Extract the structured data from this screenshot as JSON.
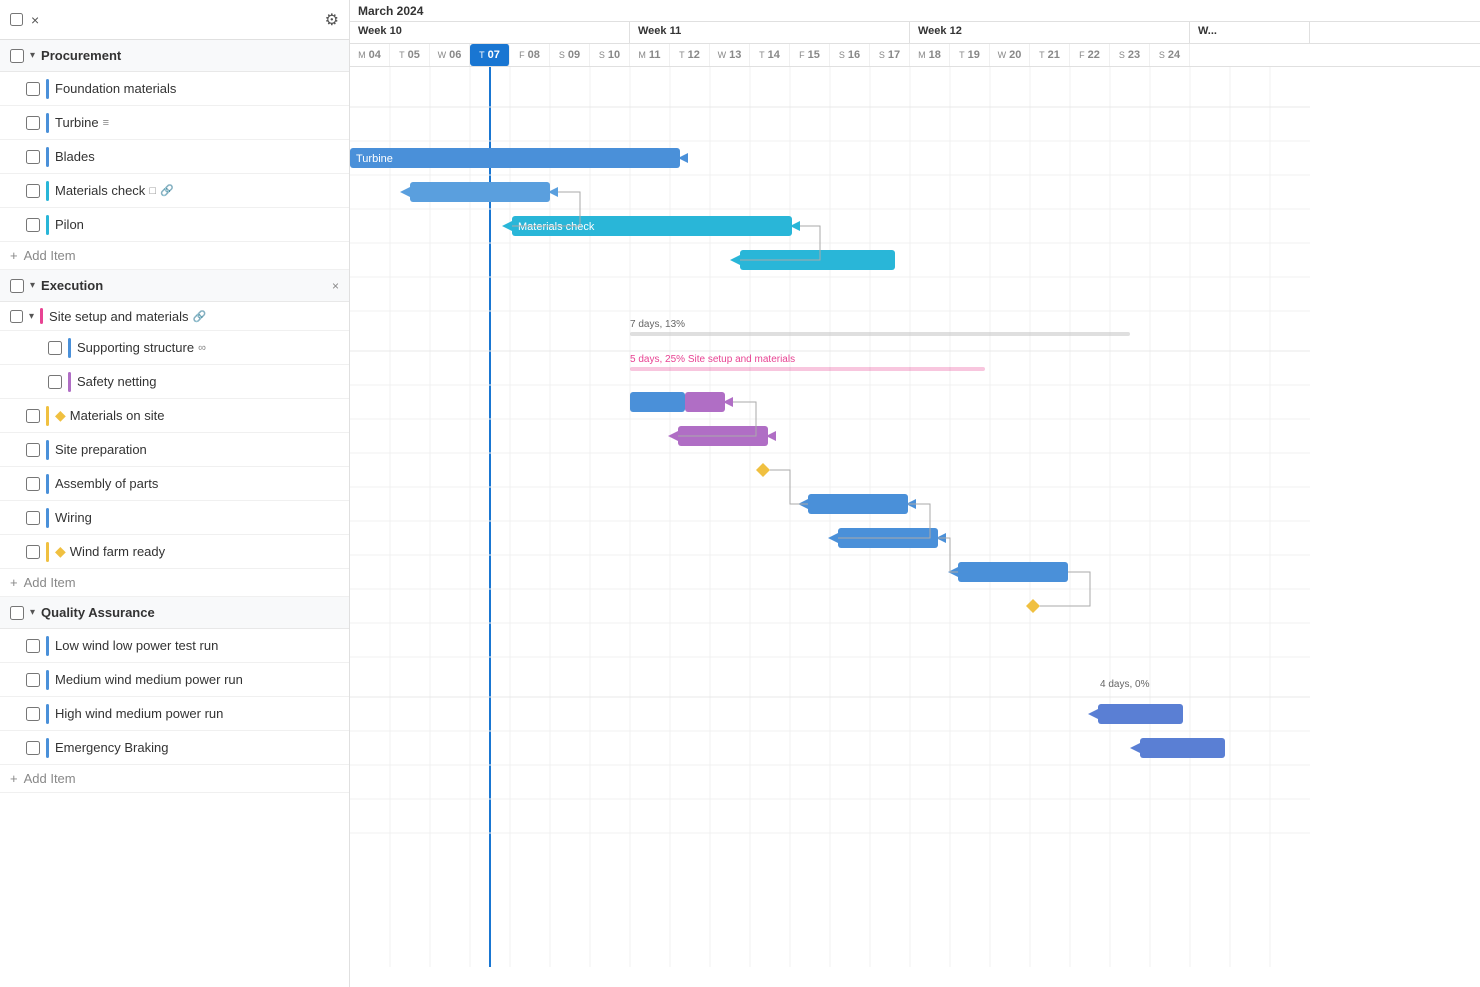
{
  "month": "March 2024",
  "weeks": [
    {
      "label": "Week 10",
      "days": [
        {
          "letter": "M",
          "num": "04"
        },
        {
          "letter": "T",
          "num": "05"
        },
        {
          "letter": "W",
          "num": "06"
        },
        {
          "letter": "T",
          "num": "07",
          "today": true
        },
        {
          "letter": "F",
          "num": "08"
        },
        {
          "letter": "S",
          "num": "09"
        },
        {
          "letter": "S",
          "num": "10"
        }
      ]
    },
    {
      "label": "Week 11",
      "days": [
        {
          "letter": "M",
          "num": "11"
        },
        {
          "letter": "T",
          "num": "12"
        },
        {
          "letter": "W",
          "num": "13"
        },
        {
          "letter": "T",
          "num": "14"
        },
        {
          "letter": "F",
          "num": "15"
        },
        {
          "letter": "S",
          "num": "16"
        },
        {
          "letter": "S",
          "num": "17"
        }
      ]
    },
    {
      "label": "Week 12",
      "days": [
        {
          "letter": "M",
          "num": "18"
        },
        {
          "letter": "T",
          "num": "19"
        },
        {
          "letter": "W",
          "num": "20"
        },
        {
          "letter": "T",
          "num": "21"
        },
        {
          "letter": "F",
          "num": "22"
        },
        {
          "letter": "S",
          "num": "23"
        },
        {
          "letter": "S",
          "num": "24"
        }
      ]
    }
  ],
  "groups": [
    {
      "title": "Procurement",
      "items": [
        {
          "label": "Foundation materials",
          "color": "#4a90d9",
          "indent": 1
        },
        {
          "label": "Turbine",
          "color": "#4a90d9",
          "indent": 1,
          "icons": "≡"
        },
        {
          "label": "Blades",
          "color": "#4a90d9",
          "indent": 1
        },
        {
          "label": "Materials check",
          "color": "#29b6d8",
          "indent": 1,
          "icons": "□ 🔗"
        },
        {
          "label": "Pilon",
          "color": "#29b6d8",
          "indent": 1
        }
      ],
      "addItem": "+ Add Item"
    },
    {
      "title": "Execution",
      "closeable": true,
      "subgroups": [
        {
          "label": "Site setup and materials",
          "color": "#e84393",
          "indent": 1,
          "icon": "🔗",
          "items": [
            {
              "label": "Supporting structure",
              "color": "#4a90d9",
              "indent": 2,
              "icons": "∞"
            },
            {
              "label": "Safety netting",
              "color": "#b06ec5",
              "indent": 2
            }
          ]
        }
      ],
      "items": [
        {
          "label": "Materials on site",
          "color": "#f0c040",
          "indent": 1,
          "diamond": true
        },
        {
          "label": "Site preparation",
          "color": "#4a90d9",
          "indent": 1
        },
        {
          "label": "Assembly of parts",
          "color": "#4a90d9",
          "indent": 1
        },
        {
          "label": "Wiring",
          "color": "#4a90d9",
          "indent": 1
        },
        {
          "label": "Wind farm ready",
          "color": "#f0c040",
          "indent": 1,
          "diamond": true
        }
      ],
      "addItem": "+ Add Item"
    },
    {
      "title": "Quality Assurance",
      "items": [
        {
          "label": "Low wind low power test run",
          "color": "#4a90d9",
          "indent": 1
        },
        {
          "label": "Medium wind medium power run",
          "color": "#4a90d9",
          "indent": 1
        },
        {
          "label": "High wind medium power run",
          "color": "#4a90d9",
          "indent": 1
        },
        {
          "label": "Emergency Braking",
          "color": "#4a90d9",
          "indent": 1
        }
      ],
      "addItem": "+ Add Item"
    }
  ],
  "ui": {
    "add_item": "+ Add Item",
    "close_icon": "×",
    "gear_icon": "⚙",
    "chevron_down": "▾",
    "checkbox_unchecked": "□"
  }
}
